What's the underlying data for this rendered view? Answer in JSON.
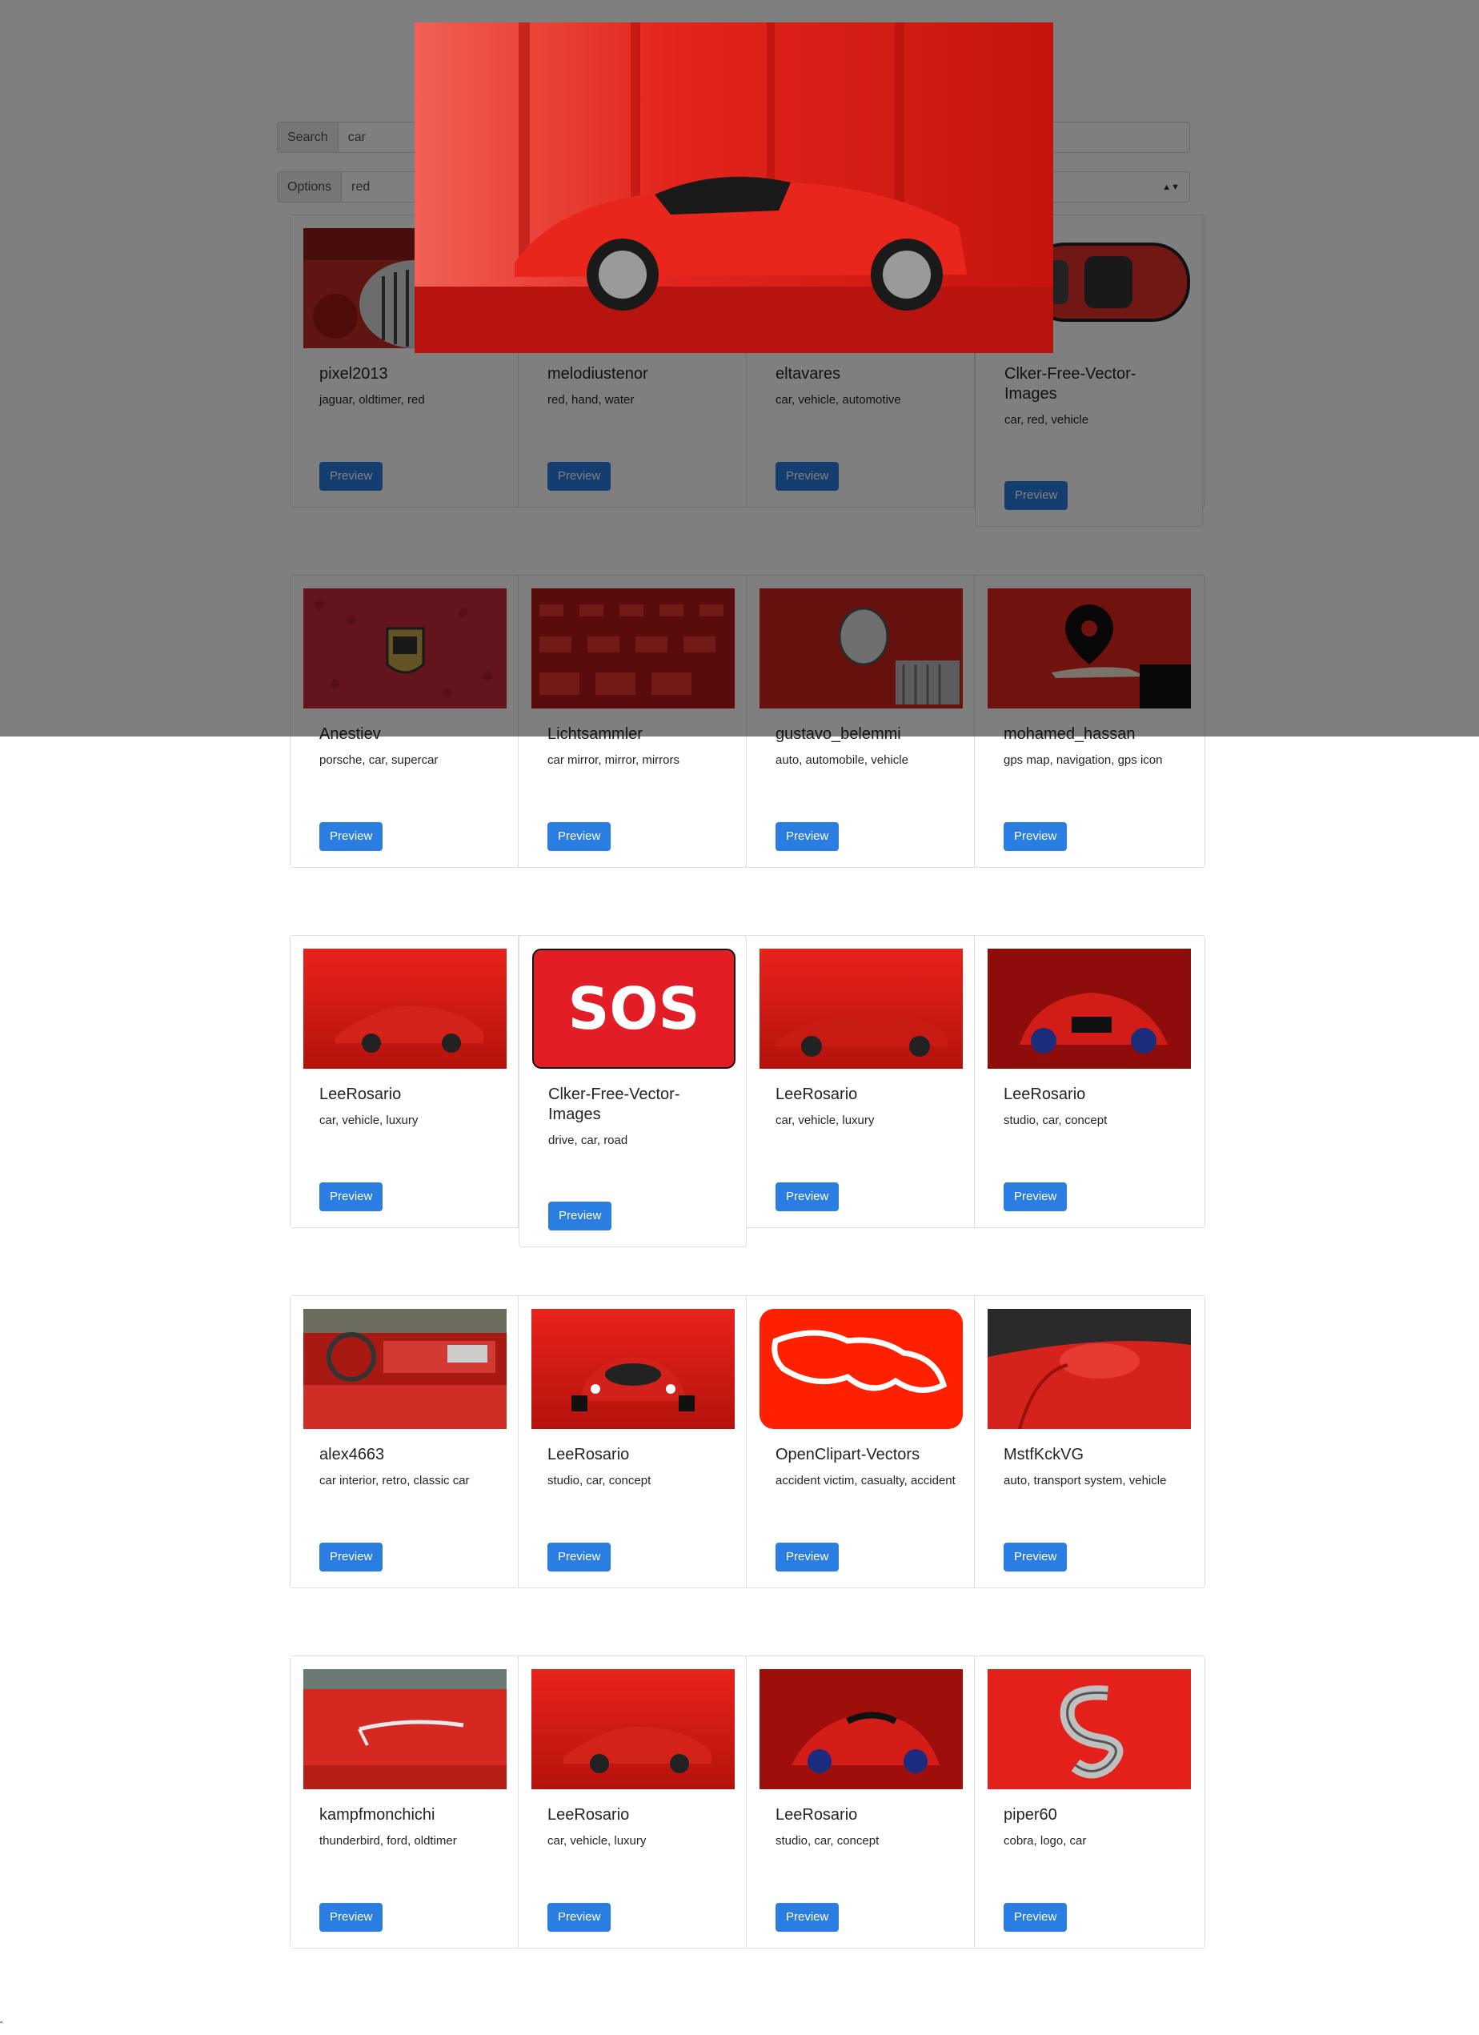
{
  "search": {
    "label": "Search",
    "value": "car"
  },
  "options": {
    "label": "Options",
    "value": "red"
  },
  "preview_label": "Preview",
  "rows": [
    [
      {
        "author": "pixel2013",
        "tags": "jaguar, oldtimer, red",
        "image": "jaguar-grille-photo"
      },
      {
        "author": "melodiustenor",
        "tags": "red, hand, water",
        "image": "red-hand-photo"
      },
      {
        "author": "eltavares",
        "tags": "car, vehicle, automotive",
        "image": "red-car-photo"
      },
      {
        "author": "Clker-Free-Vector-Images",
        "tags": "car, red, vehicle",
        "image": "red-car-topview-illustration"
      }
    ],
    [
      {
        "author": "Anestiev",
        "tags": "porsche, car, supercar",
        "image": "porsche-emblem-photo"
      },
      {
        "author": "Lichtsammler",
        "tags": "car mirror, mirror, mirrors",
        "image": "car-mirrors-photo"
      },
      {
        "author": "gustavo_belemmi",
        "tags": "auto, automobile, vehicle",
        "image": "classic-car-headlight-photo"
      },
      {
        "author": "mohamed_hassan",
        "tags": "gps map, navigation, gps icon",
        "image": "gps-pin-hand-illustration"
      }
    ],
    [
      {
        "author": "LeeRosario",
        "tags": "car, vehicle, luxury",
        "image": "red-supercar-render"
      },
      {
        "author": "Clker-Free-Vector-Images",
        "tags": "drive, car, road",
        "image": "sos-sign-illustration"
      },
      {
        "author": "LeeRosario",
        "tags": "car, vehicle, luxury",
        "image": "red-supercar-side-render"
      },
      {
        "author": "LeeRosario",
        "tags": "studio, car, concept",
        "image": "concept-car-rear-render"
      }
    ],
    [
      {
        "author": "alex4663",
        "tags": "car interior, retro, classic car",
        "image": "classic-car-interior-photo"
      },
      {
        "author": "LeeRosario",
        "tags": "studio, car, concept",
        "image": "concept-car-front-render"
      },
      {
        "author": "OpenClipart-Vectors",
        "tags": "accident victim, casualty, accident",
        "image": "body-outline-illustration"
      },
      {
        "author": "MstfKckVG",
        "tags": "auto, transport system, vehicle",
        "image": "car-side-mirror-photo"
      }
    ],
    [
      {
        "author": "kampfmonchichi",
        "tags": "thunderbird, ford, oldtimer",
        "image": "thunderbird-badge-photo"
      },
      {
        "author": "LeeRosario",
        "tags": "car, vehicle, luxury",
        "image": "red-supercar-render"
      },
      {
        "author": "LeeRosario",
        "tags": "studio, car, concept",
        "image": "concept-car-render"
      },
      {
        "author": "piper60",
        "tags": "cobra, logo, car",
        "image": "cobra-logo-photo"
      }
    ]
  ],
  "modal": {
    "image": "red-convertible-sportscar-photo"
  },
  "footer_mark": "\""
}
